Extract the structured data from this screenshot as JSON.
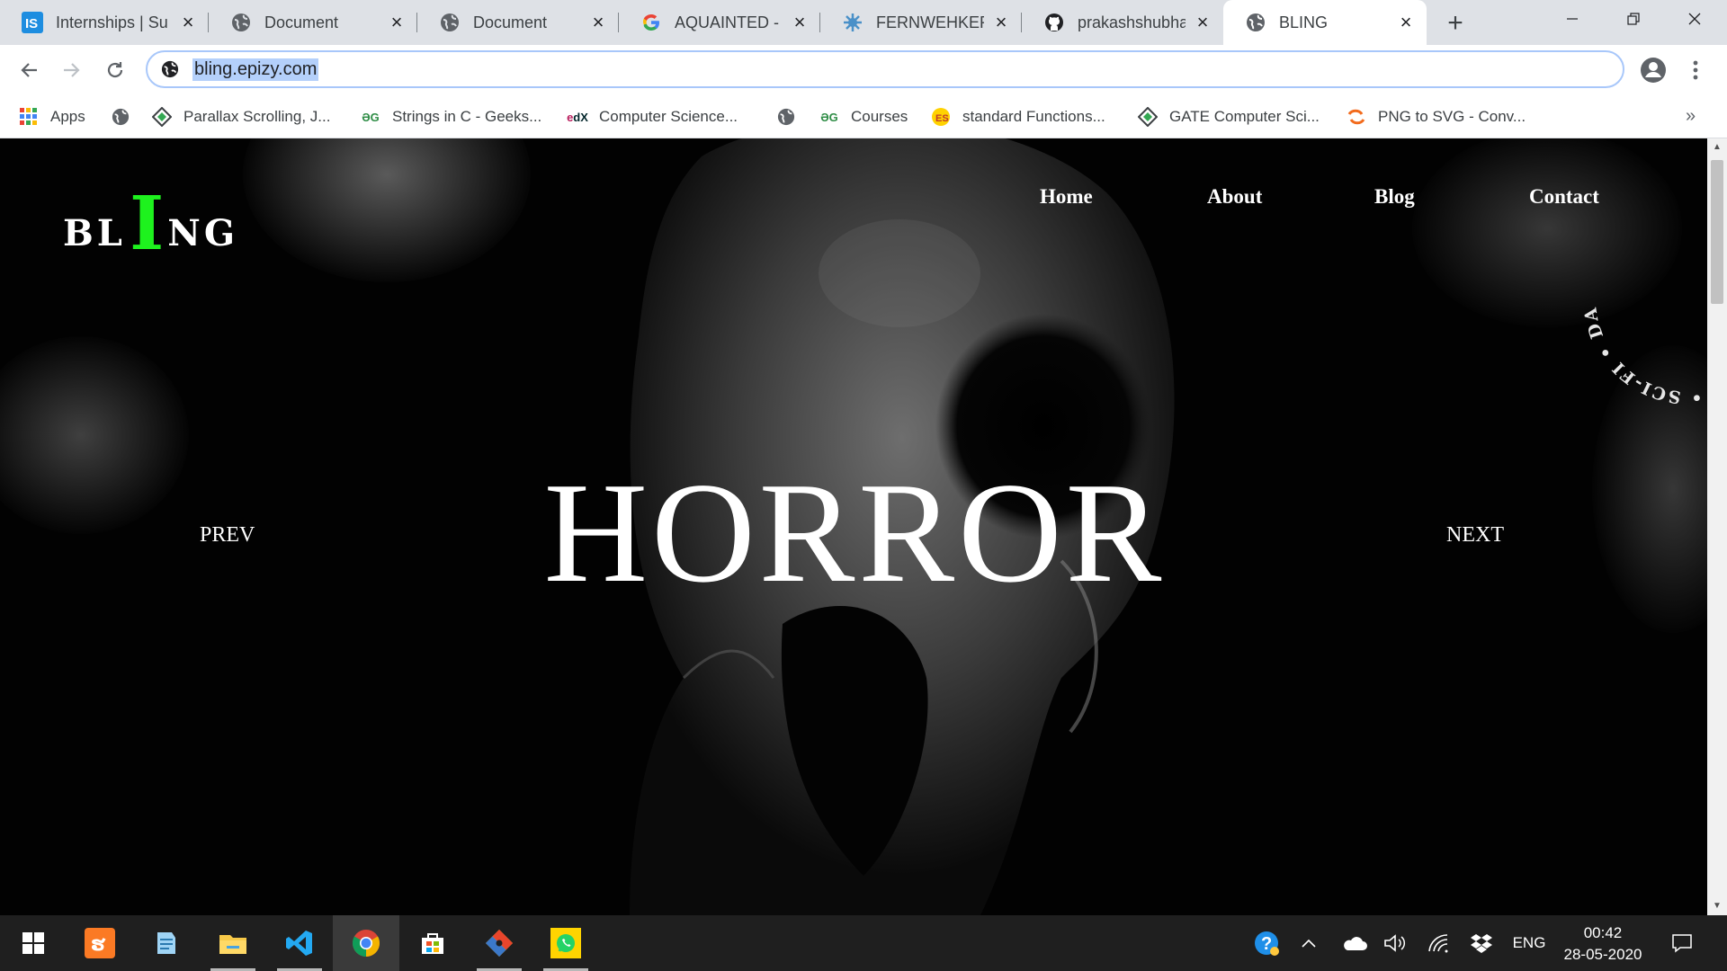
{
  "browser": {
    "tabs": [
      {
        "title": "Internships | Su",
        "icon": "internshala-icon"
      },
      {
        "title": "Document",
        "icon": "globe-icon"
      },
      {
        "title": "Document",
        "icon": "globe-icon"
      },
      {
        "title": "AQUAINTED - G",
        "icon": "google-icon"
      },
      {
        "title": "FERNWEHKER P",
        "icon": "fernwehker-icon"
      },
      {
        "title": "prakashshubhar",
        "icon": "github-icon"
      },
      {
        "title": "BLING",
        "icon": "globe-icon",
        "active": true
      }
    ],
    "new_tab_symbol": "+",
    "address": "bling.epizy.com",
    "bookmarks": [
      {
        "label": "Apps",
        "icon": "apps-grid-icon"
      },
      {
        "label": "",
        "icon": "globe-icon"
      },
      {
        "label": "Parallax Scrolling, J...",
        "icon": "diamond-icon"
      },
      {
        "label": "Strings in C - Geeks...",
        "icon": "geeksforgeeks-icon"
      },
      {
        "label": "Computer Science...",
        "icon": "edx-icon"
      },
      {
        "label": "",
        "icon": "globe-icon"
      },
      {
        "label": "Courses",
        "icon": "geeksforgeeks-icon"
      },
      {
        "label": "standard Functions...",
        "icon": "w3-icon"
      },
      {
        "label": "GATE Computer Sci...",
        "icon": "diamond-icon"
      },
      {
        "label": "PNG to SVG - Conv...",
        "icon": "converter-icon"
      }
    ],
    "more_bookmarks": "»"
  },
  "site": {
    "logo": {
      "part1": "BL",
      "highlight": "I",
      "part2": "NG"
    },
    "nav": [
      "Home",
      "About",
      "Blog",
      "Contact"
    ],
    "hero_title": "HORROR",
    "prev_label": "PREV",
    "next_label": "NEXT",
    "ring_text": "HORROR • ROMANCE • SCI-FI • DARK •",
    "colors": {
      "logo_accent": "#1ef21e",
      "background": "#000000",
      "text": "#ffffff"
    }
  },
  "taskbar": {
    "apps": [
      "windows-start-icon",
      "xampp-icon",
      "notepad-icon",
      "file-explorer-icon",
      "vscode-icon",
      "chrome-icon",
      "store-icon",
      "git-icon",
      "whatsapp-icon"
    ],
    "language": "ENG",
    "time": "00:42",
    "date": "28-05-2020"
  }
}
